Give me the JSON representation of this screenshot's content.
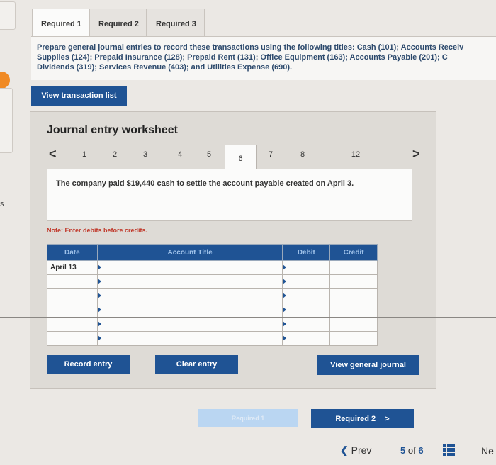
{
  "tabs": [
    {
      "label": "Required 1"
    },
    {
      "label": "Required 2"
    },
    {
      "label": "Required 3"
    }
  ],
  "instructions": {
    "line1": "Prepare general journal entries to record these transactions using the following titles: Cash (101); Accounts Receiv",
    "line2": "Supplies (124); Prepaid Insurance (128); Prepaid Rent (131); Office Equipment (163); Accounts Payable (201); C",
    "line3": "Dividends (319); Services Revenue (403); and Utilities Expense (690)."
  },
  "view_transaction_list": "View transaction list",
  "worksheet": {
    "title": "Journal entry worksheet",
    "pages": [
      "1",
      "2",
      "3",
      "4",
      "5",
      "6",
      "7",
      "8",
      "12"
    ],
    "active_page": "6",
    "prev_arrow": "<",
    "next_arrow": ">",
    "description": "The company paid $19,440 cash to settle the account payable created on April 3.",
    "note": "Note: Enter debits before credits.",
    "columns": {
      "date": "Date",
      "account": "Account Title",
      "debit": "Debit",
      "credit": "Credit"
    },
    "rows": [
      {
        "date": "April 13",
        "account": "",
        "debit": "",
        "credit": ""
      },
      {
        "date": "",
        "account": "",
        "debit": "",
        "credit": ""
      },
      {
        "date": "",
        "account": "",
        "debit": "",
        "credit": ""
      },
      {
        "date": "",
        "account": "",
        "debit": "",
        "credit": ""
      },
      {
        "date": "",
        "account": "",
        "debit": "",
        "credit": ""
      },
      {
        "date": "",
        "account": "",
        "debit": "",
        "credit": ""
      }
    ],
    "record_entry": "Record entry",
    "clear_entry": "Clear entry",
    "view_general_journal": "View general journal"
  },
  "nav_buttons": {
    "required_prev": "Required 1",
    "required_next": "Required 2",
    "next_chevron": ">"
  },
  "footer": {
    "prev": "Prev",
    "page_current": "5",
    "page_of": "of",
    "page_total": "6",
    "next": "Ne"
  },
  "edge_fragment_text": "s",
  "colors": {
    "primary": "#1f5394",
    "note": "#c0392b",
    "accent_orange": "#f08a24"
  }
}
